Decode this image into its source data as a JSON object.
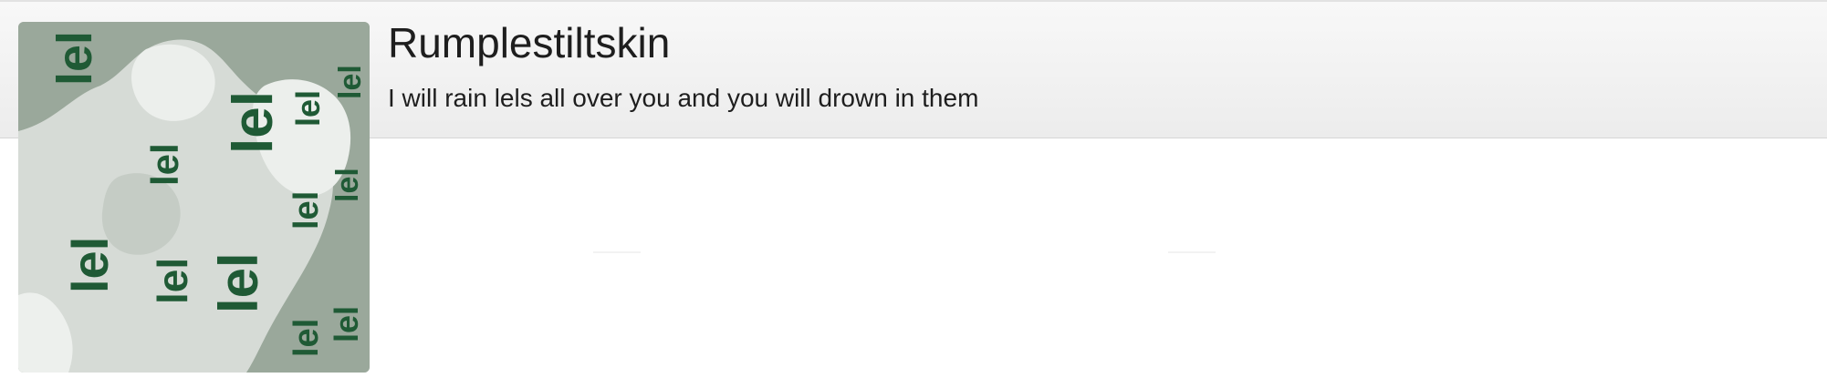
{
  "profile": {
    "name": "Rumplestiltskin",
    "bio": "I will rain lels all over you and you will drown in them",
    "avatar_word": "lel"
  },
  "colors": {
    "avatar_text": "#1f5a35",
    "avatar_bg": "#9aa89b",
    "avatar_light": "#d6dbd6"
  }
}
